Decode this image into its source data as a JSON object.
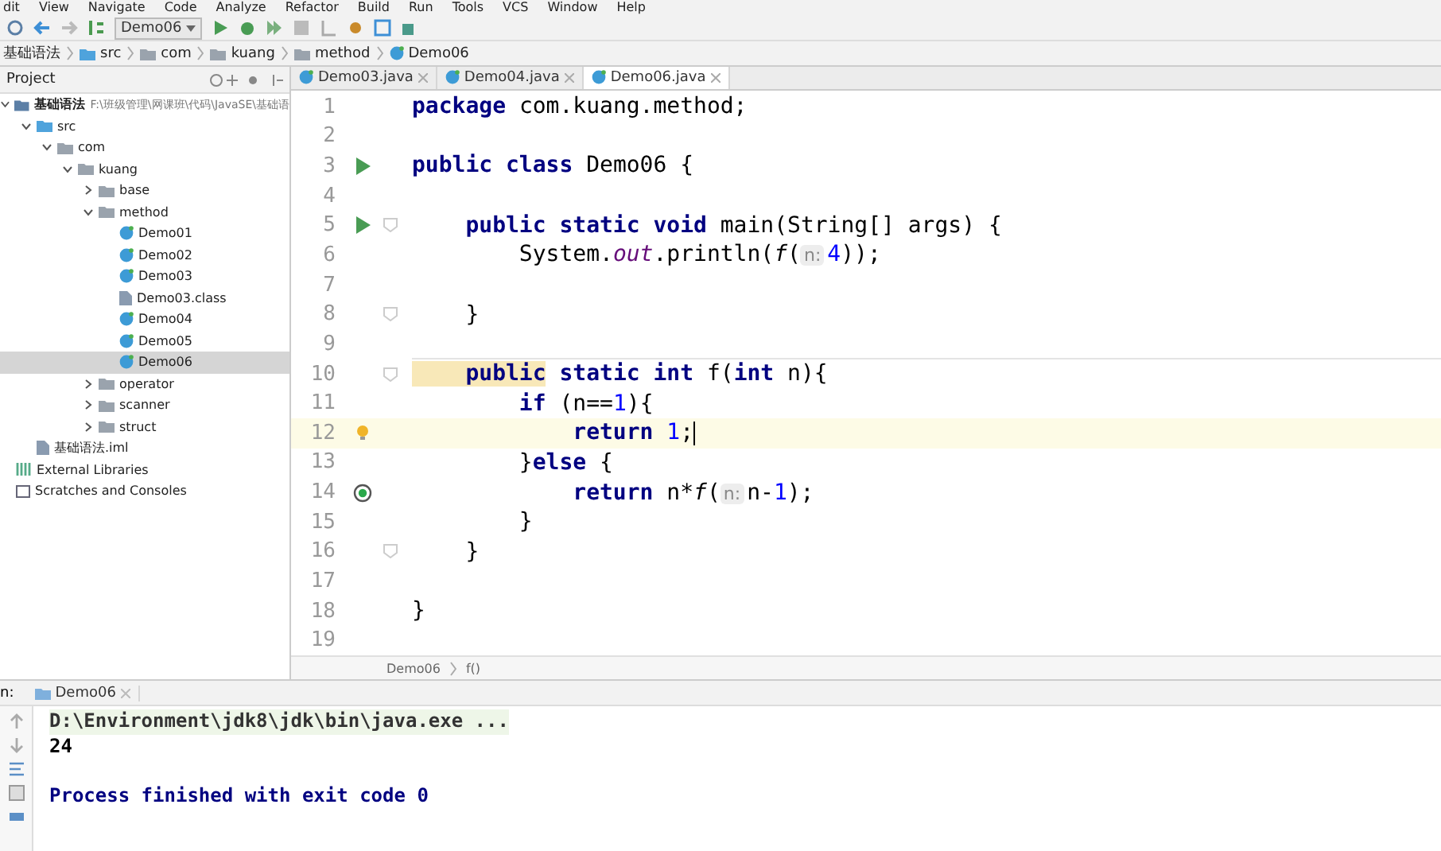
{
  "menu": [
    "dit",
    "View",
    "Navigate",
    "Code",
    "Analyze",
    "Refactor",
    "Build",
    "Run",
    "Tools",
    "VCS",
    "Window",
    "Help"
  ],
  "toolbar": {
    "run_config": "Demo06"
  },
  "nav_bar": [
    "基础语法",
    "src",
    "com",
    "kuang",
    "method",
    "Demo06"
  ],
  "project_panel": {
    "title": "Project",
    "tree": [
      {
        "label": "基础语法",
        "path": "F:\\班级管理\\网课班\\代码\\JavaSE\\基础语",
        "kind": "module",
        "expanded": true,
        "selected": false,
        "children": [
          {
            "label": "src",
            "kind": "source",
            "expanded": true,
            "selected": false,
            "children": [
              {
                "label": "com",
                "kind": "folder",
                "expanded": true,
                "selected": false,
                "children": [
                  {
                    "label": "kuang",
                    "kind": "folder",
                    "expanded": true,
                    "selected": false,
                    "children": [
                      {
                        "label": "base",
                        "kind": "folder",
                        "expanded": false,
                        "selected": false
                      },
                      {
                        "label": "method",
                        "kind": "folder",
                        "expanded": true,
                        "selected": false,
                        "children": [
                          {
                            "label": "Demo01",
                            "kind": "class",
                            "selected": false
                          },
                          {
                            "label": "Demo02",
                            "kind": "class",
                            "selected": false
                          },
                          {
                            "label": "Demo03",
                            "kind": "class",
                            "selected": false
                          },
                          {
                            "label": "Demo03.class",
                            "kind": "classfile",
                            "selected": false
                          },
                          {
                            "label": "Demo04",
                            "kind": "class",
                            "selected": false
                          },
                          {
                            "label": "Demo05",
                            "kind": "class",
                            "selected": false
                          },
                          {
                            "label": "Demo06",
                            "kind": "class",
                            "selected": true
                          }
                        ]
                      },
                      {
                        "label": "operator",
                        "kind": "folder",
                        "expanded": false,
                        "selected": false
                      },
                      {
                        "label": "scanner",
                        "kind": "folder",
                        "expanded": false,
                        "selected": false
                      },
                      {
                        "label": "struct",
                        "kind": "folder",
                        "expanded": false,
                        "selected": false
                      }
                    ]
                  }
                ]
              }
            ]
          },
          {
            "label": "基础语法.iml",
            "kind": "iml",
            "selected": false
          }
        ]
      },
      {
        "label": "External Libraries",
        "kind": "libraries",
        "selected": false
      },
      {
        "label": "Scratches and Consoles",
        "kind": "scratches",
        "selected": false
      }
    ]
  },
  "editor_tabs": [
    {
      "label": "Demo03.java",
      "selected": false
    },
    {
      "label": "Demo04.java",
      "selected": false
    },
    {
      "label": "Demo06.java",
      "selected": true
    }
  ],
  "code_lines": [
    {
      "number": "1",
      "current": false,
      "tokens": [
        {
          "t": "package",
          "kind": "kw"
        },
        {
          "t": " com.kuang.method;",
          "kind": "plain"
        }
      ]
    },
    {
      "number": "2",
      "current": false
    },
    {
      "number": "3",
      "current": false,
      "gutter": {
        "kind": "run"
      },
      "tokens": [
        {
          "t": "public class",
          "kind": "kw"
        },
        {
          "t": " Demo06 {",
          "kind": "plain"
        }
      ]
    },
    {
      "number": "4",
      "current": false
    },
    {
      "number": "5",
      "current": false,
      "gutter": {
        "kind": "run"
      },
      "fold": true,
      "tokens": [
        {
          "t": "    public static void",
          "kind": "kw"
        },
        {
          "t": " main(String[] args) {",
          "kind": "plain"
        }
      ]
    },
    {
      "number": "6",
      "current": false,
      "tokens": [
        {
          "t": "        System.",
          "kind": "plain"
        },
        {
          "t": "out",
          "kind": "field"
        },
        {
          "t": ".println(",
          "kind": "plain"
        },
        {
          "t": "f",
          "kind": "italic"
        },
        {
          "t": "(",
          "kind": "plain"
        },
        {
          "t": "n:",
          "kind": "hint"
        },
        {
          "t": "4",
          "kind": "num"
        },
        {
          "t": "));",
          "kind": "plain"
        }
      ]
    },
    {
      "number": "7",
      "current": false
    },
    {
      "number": "8",
      "current": false,
      "fold": true,
      "tokens": [
        {
          "t": "    }",
          "kind": "plain"
        }
      ]
    },
    {
      "number": "9",
      "current": false,
      "separator": true
    },
    {
      "number": "10",
      "current": false,
      "fold": true,
      "tokens": [
        {
          "t": "    public",
          "kind": "kw-highlight"
        },
        {
          "t": " static int",
          "kind": "kw"
        },
        {
          "t": " f(",
          "kind": "plain"
        },
        {
          "t": "int",
          "kind": "kw"
        },
        {
          "t": " n){",
          "kind": "plain"
        }
      ]
    },
    {
      "number": "11",
      "current": false,
      "tokens": [
        {
          "t": "        if",
          "kind": "kw"
        },
        {
          "t": " (n==",
          "kind": "plain"
        },
        {
          "t": "1",
          "kind": "num"
        },
        {
          "t": "){",
          "kind": "plain"
        }
      ]
    },
    {
      "number": "12",
      "current": true,
      "gutter": {
        "kind": "bulb"
      },
      "tokens": [
        {
          "t": "            return ",
          "kind": "kw"
        },
        {
          "t": "1",
          "kind": "num"
        },
        {
          "t": ";",
          "kind": "plain"
        }
      ]
    },
    {
      "number": "13",
      "current": false,
      "tokens": [
        {
          "t": "        }",
          "kind": "plain"
        },
        {
          "t": "else",
          "kind": "kw"
        },
        {
          "t": " {",
          "kind": "plain"
        }
      ]
    },
    {
      "number": "14",
      "current": false,
      "gutter": {
        "kind": "recursion"
      },
      "tokens": [
        {
          "t": "            return",
          "kind": "kw"
        },
        {
          "t": " n*",
          "kind": "plain"
        },
        {
          "t": "f",
          "kind": "italic"
        },
        {
          "t": "(",
          "kind": "plain"
        },
        {
          "t": "n:",
          "kind": "hint"
        },
        {
          "t": "n-",
          "kind": "plain"
        },
        {
          "t": "1",
          "kind": "num"
        },
        {
          "t": ");",
          "kind": "plain"
        }
      ]
    },
    {
      "number": "15",
      "current": false,
      "tokens": [
        {
          "t": "        }",
          "kind": "plain"
        }
      ]
    },
    {
      "number": "16",
      "current": false,
      "fold": true,
      "tokens": [
        {
          "t": "    }",
          "kind": "plain"
        }
      ]
    },
    {
      "number": "17",
      "current": false
    },
    {
      "number": "18",
      "current": false,
      "tokens": [
        {
          "t": "}",
          "kind": "plain"
        }
      ]
    },
    {
      "number": "19",
      "current": false
    }
  ],
  "editor_breadcrumb": [
    "Demo06",
    "f()"
  ],
  "run_panel": {
    "label": "n:",
    "tab": "Demo06",
    "output": [
      {
        "text": "D:\\Environment\\jdk8\\jdk\\bin\\java.exe ...",
        "kind": "command"
      },
      {
        "text": "24",
        "kind": "stdout"
      },
      {
        "kind": "blank"
      },
      {
        "text": "Process finished with exit code 0",
        "kind": "system"
      }
    ]
  }
}
